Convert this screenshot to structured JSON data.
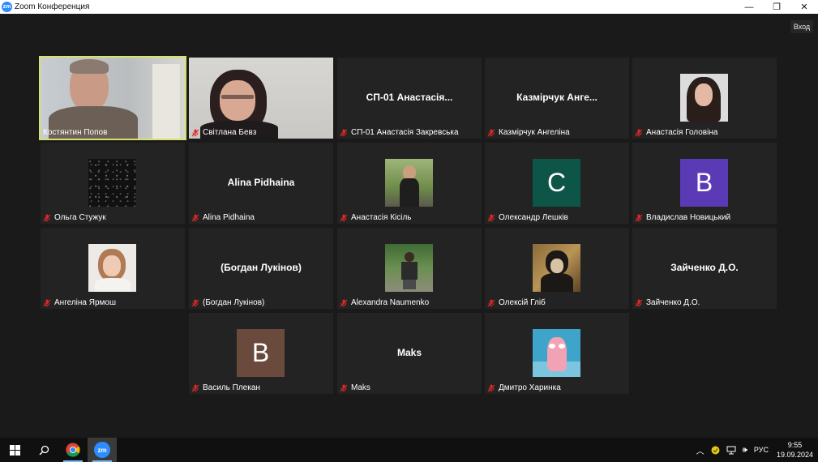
{
  "window": {
    "title": "Zoom Конференция",
    "app_icon_text": "zm",
    "minimize_glyph": "—",
    "restore_glyph": "❐",
    "close_glyph": "✕"
  },
  "meeting": {
    "exit_label": "Вход",
    "participants": [
      {
        "name": "Костянтин Попов",
        "display": "",
        "muted": false,
        "type": "video-man",
        "active": true
      },
      {
        "name": "Світлана Бевз",
        "display": "",
        "muted": true,
        "type": "video-woman",
        "active": false
      },
      {
        "name": "СП-01 Анастасія Закревська",
        "display": "СП-01  Анастасія...",
        "muted": true,
        "type": "text",
        "active": false
      },
      {
        "name": "Казмірчук  Ангеліна",
        "display": "Казмірчук  Анге...",
        "muted": true,
        "type": "text",
        "active": false
      },
      {
        "name": "Анастасія Головіна",
        "display": "",
        "muted": true,
        "type": "photo-portrait",
        "active": false
      },
      {
        "name": "Ольга Стужук",
        "display": "",
        "muted": true,
        "type": "photo-stars",
        "active": false
      },
      {
        "name": "Alina Pidhaina",
        "display": "Alina Pidhaina",
        "muted": true,
        "type": "text",
        "active": false
      },
      {
        "name": "Анастасія Кісіль",
        "display": "",
        "muted": true,
        "type": "photo-outdoor",
        "active": false
      },
      {
        "name": "Олександр Лешків",
        "display": "C",
        "muted": true,
        "type": "letter",
        "color": "#0d5647",
        "active": false
      },
      {
        "name": "Владислав Новицький",
        "display": "B",
        "muted": true,
        "type": "letter",
        "color": "#5b3bb5",
        "active": false
      },
      {
        "name": "Ангеліна Ярмош",
        "display": "",
        "muted": true,
        "type": "photo-light",
        "active": false
      },
      {
        "name": "(Богдан Лукінов)",
        "display": "(Богдан Лукінов)",
        "muted": true,
        "type": "text",
        "active": false
      },
      {
        "name": "Alexandra Naumenko",
        "display": "",
        "muted": true,
        "type": "photo-green",
        "active": false
      },
      {
        "name": "Олексій Гліб",
        "display": "",
        "muted": true,
        "type": "photo-anime",
        "active": false
      },
      {
        "name": "Зайченко Д.О.",
        "display": "Зайченко Д.О.",
        "muted": true,
        "type": "text",
        "active": false
      },
      {
        "name": "Василь Плекан",
        "display": "B",
        "muted": true,
        "type": "letter",
        "color": "#6b4a3e",
        "active": false
      },
      {
        "name": "Maks",
        "display": "Maks",
        "muted": true,
        "type": "text",
        "active": false
      },
      {
        "name": "Дмитро Харинка",
        "display": "",
        "muted": true,
        "type": "photo-cartoon",
        "active": false
      }
    ]
  },
  "taskbar": {
    "language": "РУС",
    "time": "9:55",
    "date": "19.09.2024",
    "tray_chevron": "︿",
    "volume_glyph": "🕪",
    "zoom_icon_text": "zm"
  },
  "colors": {
    "accent_active": "#d6e36a",
    "mute_red": "#e02828",
    "zoom_blue": "#2d8cff"
  }
}
